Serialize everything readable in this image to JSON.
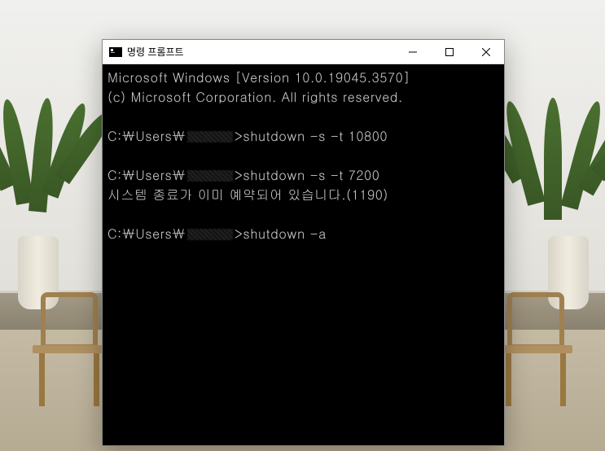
{
  "window": {
    "title": "명령 프롬프트"
  },
  "terminal": {
    "line1": "Microsoft Windows [Version 10.0.19045.3570]",
    "line2": "(c) Microsoft Corporation. All rights reserved.",
    "prompt_prefix": "C:￦Users￦",
    "prompt_gt": ">",
    "cmd1": "shutdown -s -t 10800",
    "cmd2": "shutdown -s -t 7200",
    "msg2": "시스템 종료가 이미 예약되어 있습니다.(1190)",
    "cmd3": "shutdown -a"
  }
}
